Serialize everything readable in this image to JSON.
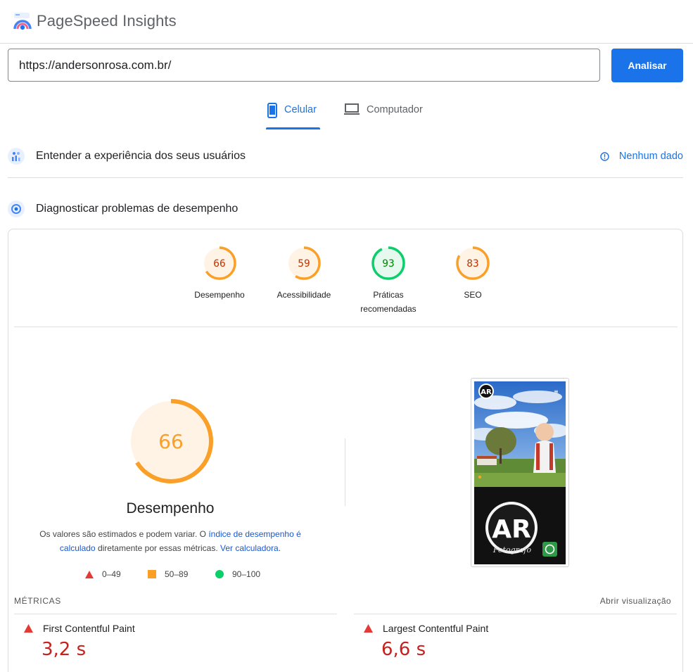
{
  "header": {
    "brand": "PageSpeed Insights",
    "logo_icon": "pagespeed-logo-icon"
  },
  "search": {
    "url_value": "https://andersonrosa.com.br/",
    "analyze_label": "Analisar"
  },
  "tabs": [
    {
      "label": "Celular",
      "icon": "phone-icon",
      "active": true
    },
    {
      "label": "Computador",
      "icon": "laptop-icon",
      "active": false
    }
  ],
  "field_data": {
    "title": "Entender a experiência dos seus usuários",
    "no_data_label": "Nenhum dado",
    "icon": "users-chart-icon"
  },
  "lab_data": {
    "title": "Diagnosticar problemas de desempenho",
    "icon": "lighthouse-icon"
  },
  "scores": [
    {
      "label": "Desempenho",
      "value": 66,
      "color": "#fa9f27"
    },
    {
      "label": "Acessibilidade",
      "value": 59,
      "color": "#fa9f27"
    },
    {
      "label": "Práticas recomendadas",
      "value": 93,
      "color": "#0cce6b"
    },
    {
      "label": "SEO",
      "value": 83,
      "color": "#fa9f27"
    }
  ],
  "performance": {
    "score": 66,
    "title": "Desempenho",
    "desc_pre": "Os valores são estimados e podem variar. O ",
    "desc_link1": "índice de desempenho é calculado",
    "desc_mid": " diretamente por essas métricas. ",
    "desc_link2": "Ver calculadora",
    "desc_end": "."
  },
  "legend": [
    {
      "range": "0–49",
      "shape": "triangle",
      "color": "#e53935"
    },
    {
      "range": "50–89",
      "shape": "square",
      "color": "#fa9f27"
    },
    {
      "range": "90–100",
      "shape": "circle",
      "color": "#0cce6b"
    }
  ],
  "metrics": {
    "heading": "MÉTRICAS",
    "expand_label": "Abrir visualização",
    "items": [
      {
        "name": "First Contentful Paint",
        "value": "3,2 s"
      },
      {
        "name": "Largest Contentful Paint",
        "value": "6,6 s"
      }
    ]
  },
  "screenshot": {
    "logo_text": "AR",
    "signature": "Fotografo"
  },
  "colors": {
    "accent": "#1a73e8",
    "average": "#fa9f27",
    "pass": "#0cce6b",
    "fail": "#e53935"
  }
}
